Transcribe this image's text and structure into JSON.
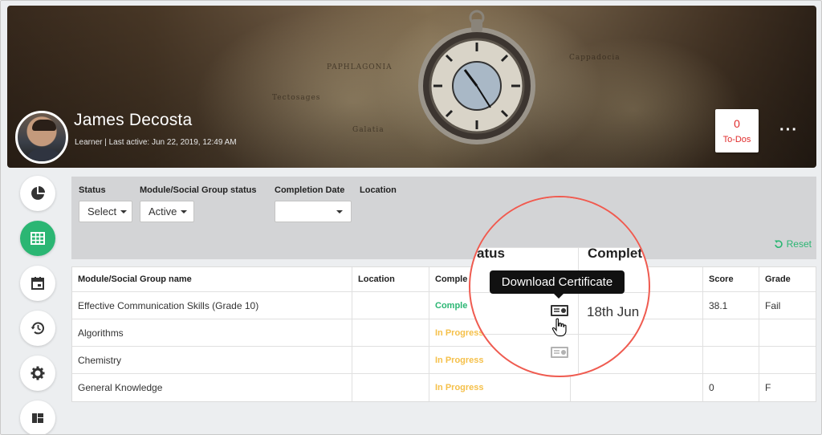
{
  "profile": {
    "name": "James Decosta",
    "meta": "Learner | Last active: Jun 22, 2019, 12:49 AM",
    "todos_count": "0",
    "todos_label": "To-Dos",
    "more_icon": "more-dots-icon"
  },
  "banner_map_text": [
    "PAPHLAGONIA",
    "Galatia",
    "Cappadocia",
    "Tectosages"
  ],
  "sidebar": {
    "items": [
      {
        "icon": "pie-chart-icon",
        "active": false
      },
      {
        "icon": "table-grid-icon",
        "active": true
      },
      {
        "icon": "calendar-icon",
        "active": false
      },
      {
        "icon": "history-icon",
        "active": false
      },
      {
        "icon": "gear-icon",
        "active": false
      },
      {
        "icon": "dashboard-layout-icon",
        "active": false
      }
    ]
  },
  "filters": {
    "status_label": "Status",
    "status_value": "Select",
    "module_status_label": "Module/Social Group status",
    "module_status_value": "Active",
    "completion_date_label": "Completion Date",
    "completion_date_value": "",
    "location_label": "Location",
    "reset_label": "Reset"
  },
  "table": {
    "headers": {
      "name": "Module/Social Group name",
      "location": "Location",
      "status": "Comple",
      "completion": "Completion date",
      "score": "Score",
      "grade": "Grade"
    },
    "rows": [
      {
        "name": "Effective Communication Skills (Grade 10)",
        "location": "",
        "status": "Comple",
        "status_type": "complete",
        "completion": "18th Jun",
        "score": "38.1",
        "grade": "Fail"
      },
      {
        "name": "Algorithms",
        "location": "",
        "status": "In Progress",
        "status_type": "progress",
        "completion": "",
        "score": "",
        "grade": ""
      },
      {
        "name": "Chemistry",
        "location": "",
        "status": "In Progress",
        "status_type": "progress",
        "completion": "",
        "score": "",
        "grade": ""
      },
      {
        "name": "General Knowledge",
        "location": "",
        "status": "In Progress",
        "status_type": "progress",
        "completion": "",
        "score": "0",
        "grade": "F"
      }
    ]
  },
  "magnifier": {
    "header_status_fragment": "atus",
    "header_completion_fragment": "Complet",
    "tooltip": "Download Certificate",
    "date": "18th Jun"
  },
  "colors": {
    "accent_green": "#2bb673",
    "progress_yellow": "#f5c04a",
    "todo_red": "#e02c2c",
    "magnifier_ring": "#ef5b50"
  }
}
